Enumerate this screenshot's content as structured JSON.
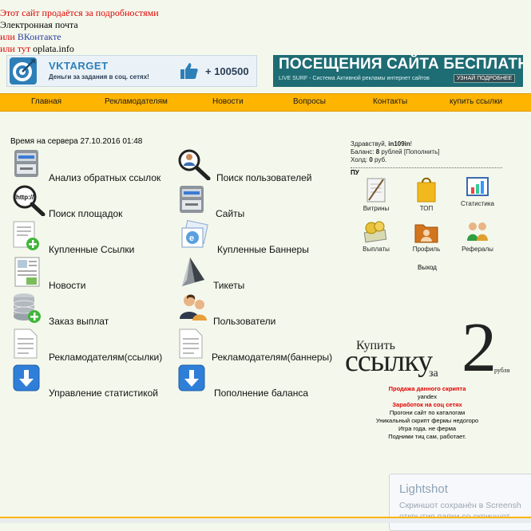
{
  "header_links": {
    "sale": "Этот сайт продаётся за подробностями",
    "email": "Электронная почта",
    "or1": "или",
    "vk": "ВКонтакте",
    "or2": "или тут",
    "oplata": "oplata.info"
  },
  "vk_banner": {
    "brand": "VKTARGET",
    "tagline": "Деньги за задания в соц. сетях!",
    "count": "+ 100500",
    "accent": "#2e7fb8"
  },
  "surf_banner": {
    "title": "ПОСЕЩЕНИЯ САЙТА БЕСПЛАТНО",
    "subtitle": "LIVE SURF - Система Активной рекламы интернет сайтов",
    "button": "УЗНАЙ ПОДРОБНЕЕ",
    "bg": "#1e6c74"
  },
  "nav": [
    "Главная",
    "Рекламодателям",
    "Новости",
    "Вопросы",
    "Контакты",
    "купить ссылки"
  ],
  "nav_color": "#ffb400",
  "server_time": "Время на сервера 27.10.2016 01:48",
  "admin_menu": [
    {
      "label": "Анализ обратных ссылок",
      "icon": "server-icon"
    },
    {
      "label": "Поиск пользователей",
      "icon": "user-search-icon"
    },
    {
      "label": "Поиск площадок",
      "icon": "http-search-icon"
    },
    {
      "label": "Сайты",
      "icon": "server-icon"
    },
    {
      "label": "Купленные Ссылки",
      "icon": "document-add-icon"
    },
    {
      "label": "Купленные Баннеры",
      "icon": "image-icon"
    },
    {
      "label": "Новости",
      "icon": "newspaper-icon"
    },
    {
      "label": "Тикеты",
      "icon": "ticket-icon"
    },
    {
      "label": "Заказ выплат",
      "icon": "database-add-icon"
    },
    {
      "label": "Пользователи",
      "icon": "users-icon"
    },
    {
      "label": "Рекламодателям(ссылки)",
      "icon": "document-icon"
    },
    {
      "label": "Рекламодателям(баннеры)",
      "icon": "document-icon"
    },
    {
      "label": "Управление статистикой",
      "icon": "download-icon"
    },
    {
      "label": "Пополнение баланса",
      "icon": "download-icon"
    }
  ],
  "user_panel": {
    "greeting": "Здравствуй, ",
    "username": "in109in",
    "greeting_end": "!",
    "balance_label": "Баланс: ",
    "balance_value": "8",
    "balance_unit": " рублей ",
    "topup": "[Пополнить]",
    "hold_label": "Холд: ",
    "hold_value": "0",
    "hold_unit": " руб.",
    "section": "ПУ",
    "items": [
      {
        "label": "Витрины",
        "icon": "notepad-icon"
      },
      {
        "label": "ТОП",
        "icon": "shopping-bag-icon"
      },
      {
        "label": "Статистика",
        "icon": "chart-icon"
      },
      {
        "label": "Выплаты",
        "icon": "money-icon"
      },
      {
        "label": "Профиль",
        "icon": "folder-user-icon"
      },
      {
        "label": "Рефералы",
        "icon": "group-icon"
      }
    ],
    "exit": "Выход"
  },
  "promo": {
    "logo_buy": "Купить",
    "logo_link": "ссылку",
    "logo_za": "за",
    "logo_two": "2",
    "logo_rub": "рубля",
    "sale_title": "Продажа данного скрипта",
    "yandex": "yandex",
    "earn_title": "Заработок на соц сетях",
    "lines": [
      "Прогони сайт по каталогам",
      "Уникальный скрипт фермы недогоро",
      "Игра года. не ферма",
      "Подними тиц сам, работает."
    ]
  },
  "lightshot": {
    "title": "Lightshot",
    "msg1": "Скриншот сохранён в Screensh",
    "msg2": "открытия папки со скриншот"
  }
}
